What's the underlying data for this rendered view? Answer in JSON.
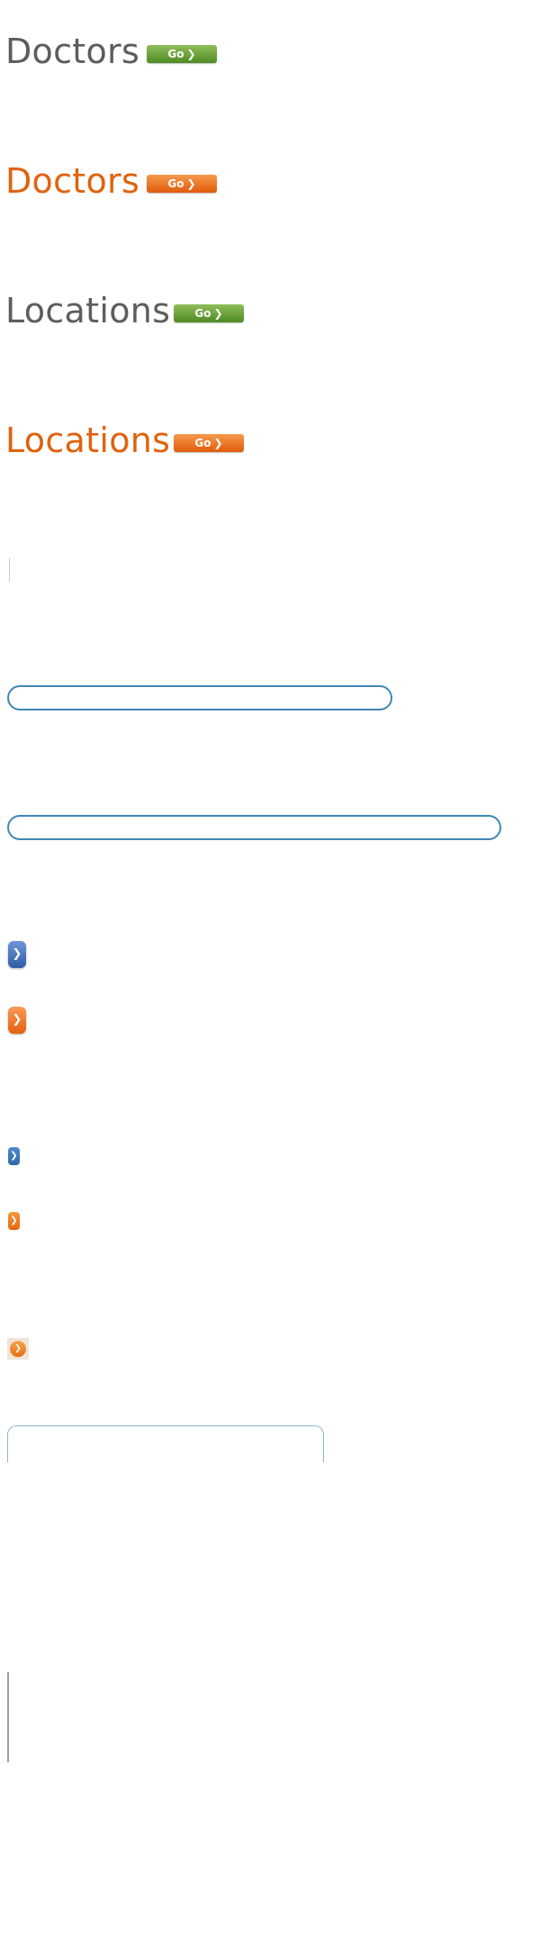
{
  "sprites": [
    {
      "heading": "Doctors",
      "heading_color": "#5d5d5d",
      "button_label": "Go",
      "button_color": "green",
      "chevron": "❯"
    },
    {
      "heading": "Doctors",
      "heading_color": "#e0630f",
      "button_label": "Go",
      "button_color": "orange",
      "chevron": "❯"
    },
    {
      "heading": "Locations",
      "heading_color": "#5d5d5d",
      "button_label": "Go",
      "button_color": "green",
      "chevron": "❯"
    },
    {
      "heading": "Locations",
      "heading_color": "#e0630f",
      "button_label": "Go",
      "button_color": "orange",
      "chevron": "❯"
    }
  ],
  "inputs": {
    "search_short": {
      "value": "",
      "placeholder": ""
    },
    "search_long": {
      "value": "",
      "placeholder": ""
    }
  },
  "arrows": {
    "glyph": "❯",
    "icons": [
      "chevron-right-icon"
    ]
  },
  "colors": {
    "green": "#6aa23c",
    "orange": "#ec6f16",
    "blue": "#3a6fb8",
    "border_blue": "#3f87b3",
    "text_gray": "#5d5d5d"
  }
}
